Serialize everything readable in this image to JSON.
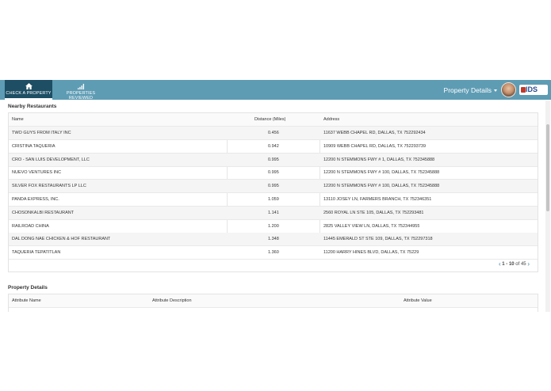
{
  "nav": {
    "tabs": [
      {
        "label": "CHECK A PROPERTY",
        "icon": "home-icon"
      },
      {
        "label": "PROPERTIES REVIEWED",
        "icon": "signal-bars-icon"
      }
    ],
    "property_details_menu": "Property Details",
    "logo_text": "IDS"
  },
  "restaurants": {
    "title": "Nearby Restaurants",
    "columns": [
      "Name",
      "Distance (Miles)",
      "Address"
    ],
    "rows": [
      {
        "name": "TWO GUYS FROM ITALY INC",
        "distance": "0.456",
        "address": "11637 WEBB CHAPEL RD, DALLAS, TX 752292434"
      },
      {
        "name": "CRISTINA TAQUERIA",
        "distance": "0.942",
        "address": "10909 WEBB CHAPEL RD, DALLAS, TX 752293739"
      },
      {
        "name": "CRO - SAN LUIS DEVELOPMENT, LLC",
        "distance": "0.995",
        "address": "12200 N STEMMONS FWY # 1, DALLAS, TX 752345888"
      },
      {
        "name": "NUEVO VENTURES INC",
        "distance": "0.995",
        "address": "12200 N STEMMONS FWY # 100, DALLAS, TX 752345888"
      },
      {
        "name": "SILVER FOX RESTAURANTS LP LLC",
        "distance": "0.995",
        "address": "12200 N STEMMONS FWY # 100, DALLAS, TX 752345888"
      },
      {
        "name": "PANDA EXPRESS, INC.",
        "distance": "1.059",
        "address": "13110 JOSEY LN, FARMERS BRANCH, TX 752346351"
      },
      {
        "name": "CHOSONKALBI RESTAURANT",
        "distance": "1.141",
        "address": "2560 ROYAL LN STE 105, DALLAS, TX 752293481"
      },
      {
        "name": "RAILROAD CHINA",
        "distance": "1.200",
        "address": "2825 VALLEY VIEW LN, DALLAS, TX 752344955"
      },
      {
        "name": "DAL DONG NAE CHICKEN & HOF RESTAURANT",
        "distance": "1.348",
        "address": "11445 EMERALD ST STE 109, DALLAS, TX 752297318"
      },
      {
        "name": "TAQUERIA TEPATITLAN",
        "distance": "1.360",
        "address": "11200 HARRY HINES BLVD, DALLAS, TX 75229"
      }
    ],
    "pager": {
      "range": "1 - 10",
      "of_text": "of 45"
    }
  },
  "property_details": {
    "title": "Property Details",
    "columns": [
      "Attribute Name",
      "Attribute Description",
      "Attribute Value"
    ]
  },
  "colors": {
    "header": "#5e9cb4",
    "active_tab": "#1d4e63",
    "link": "#3a7ea1"
  }
}
